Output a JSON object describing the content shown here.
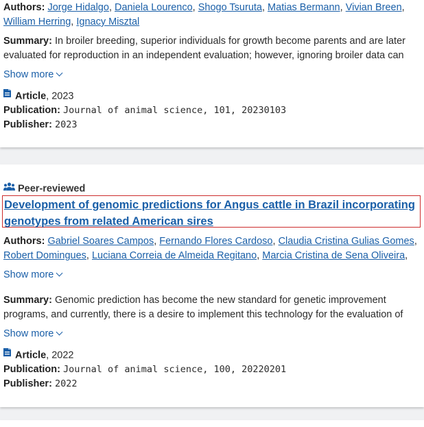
{
  "card1": {
    "authors_label": "Authors:",
    "authors": [
      "Jorge Hidalgo",
      "Daniela Lourenco",
      "Shogo Tsuruta",
      "Matias Bermann",
      "Vivian Breen",
      "William Herring",
      "Ignacy Misztal"
    ],
    "summary_label": "Summary:",
    "summary_line1": "In broiler breeding, superior individuals for growth become parents and are later",
    "summary_line2": "evaluated for reproduction in an independent evaluation; however, ignoring broiler data can",
    "show_more": "Show more",
    "type": "Article",
    "year": ", 2023",
    "publication_label": "Publication:",
    "publication": "Journal of animal science, 101, 20230103",
    "publisher_label": "Publisher:",
    "publisher": "2023"
  },
  "card2": {
    "badge": "Peer-reviewed",
    "title_line1": "Development of genomic predictions for Angus cattle in Brazil incorporating",
    "title_line2": "genotypes from related American sires",
    "authors_label": "Authors:",
    "authors": [
      "Gabriel Soares Campos",
      "Fernando Flores Cardoso",
      "Claudia Cristina Gulias Gomes",
      "Robert Domingues",
      "Luciana Correia de Almeida Regitano",
      "Marcia Cristina de Sena Oliveira"
    ],
    "show_more_authors": "Show more",
    "summary_label": "Summary:",
    "summary_line1": "Genomic prediction has become the new standard for genetic improvement",
    "summary_line2": "programs, and currently, there is a desire to implement this technology for the evaluation of",
    "show_more_summary": "Show more",
    "type": "Article",
    "year": ", 2022",
    "publication_label": "Publication:",
    "publication": "Journal of animal science, 100, 20220201",
    "publisher_label": "Publisher:",
    "publisher": "2022"
  },
  "icons": {
    "document": "document-icon",
    "peer": "people-icon",
    "chevron": "chevron-down-icon"
  },
  "colors": {
    "link": "#1a5fa8",
    "highlight_border": "#cc2b2b",
    "background": "#f0f1f3"
  }
}
